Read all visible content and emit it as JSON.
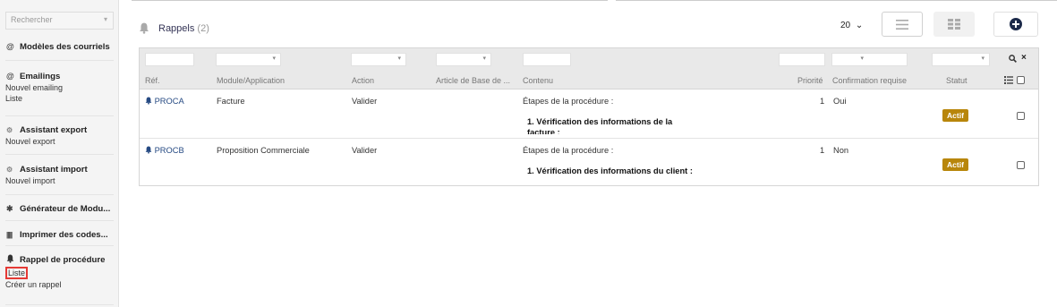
{
  "sidebar": {
    "search_placeholder": "Rechercher",
    "search_caret": "▾",
    "modeles": {
      "title": "Modèles des courriels"
    },
    "emailings": {
      "title": "Emailings",
      "items": [
        "Nouvel emailing",
        "Liste"
      ]
    },
    "export": {
      "title": "Assistant export",
      "items": [
        "Nouvel export"
      ]
    },
    "import": {
      "title": "Assistant import",
      "items": [
        "Nouvel import"
      ]
    },
    "generator": {
      "title": "Générateur de Modu..."
    },
    "barcodes": {
      "title": "Imprimer des codes..."
    },
    "rappel": {
      "title": "Rappel de procédure",
      "items": [
        "Liste",
        "Créer un rappel"
      ]
    }
  },
  "header": {
    "title": "Rappels",
    "count": "(2)",
    "per_page": "20",
    "per_page_caret": "⌄"
  },
  "table": {
    "columns": [
      "Réf.",
      "Module/Application",
      "Action",
      "Article de Base de ...",
      "Contenu",
      "Priorité",
      "Confirmation requise",
      "Statut"
    ],
    "rows": [
      {
        "ref": "PROCA",
        "module": "Facture",
        "action": "Valider",
        "article": "",
        "content_title": "Étapes de la procédure :",
        "content_step": "1. Vérification des informations de la facture :",
        "priority": "1",
        "confirmation": "Oui",
        "status": "Actif"
      },
      {
        "ref": "PROCB",
        "module": "Proposition Commerciale",
        "action": "Valider",
        "article": "",
        "content_title": "Étapes de la procédure :",
        "content_step": "1. Vérification des informations du client :",
        "priority": "1",
        "confirmation": "Non",
        "status": "Actif"
      }
    ]
  },
  "colors": {
    "accent_blue": "#264a83",
    "badge_bg": "#b8860b",
    "highlight_red": "#e53935"
  }
}
